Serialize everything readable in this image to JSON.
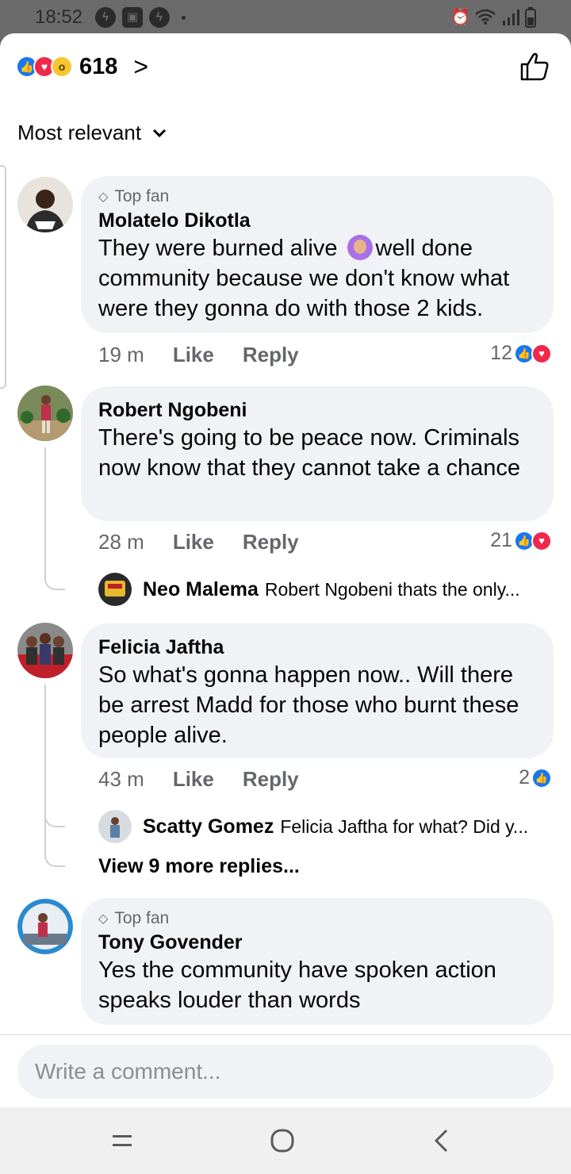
{
  "status_bar": {
    "time": "18:52",
    "left_icons": [
      "messenger-icon",
      "image-icon",
      "notification-icon"
    ],
    "right_icons": [
      "alarm-icon",
      "wifi-icon",
      "signal-icon",
      "battery-icon"
    ]
  },
  "header": {
    "reaction_count": "618",
    "reaction_types": [
      "like",
      "love",
      "wow"
    ]
  },
  "sort": {
    "label": "Most relevant"
  },
  "comments": [
    {
      "badge": "Top fan",
      "author": "Molatelo Dikotla",
      "text_before_emoji": "They were burned alive ",
      "text_after_emoji": "well done community because we don't know what were they gonna do with those 2 kids.",
      "time": "19 m",
      "like": "Like",
      "reply": "Reply",
      "reactions": "12"
    },
    {
      "author": "Robert Ngobeni",
      "text": "There's going to be peace now. Criminals now know that they cannot take a chance",
      "time": "28 m",
      "like": "Like",
      "reply": "Reply",
      "reactions": "21",
      "reply_preview": {
        "name": "Neo Malema",
        "snippet": "Robert Ngobeni thats the only..."
      }
    },
    {
      "author": "Felicia Jaftha",
      "text": "So what's gonna happen now.. Will there be arrest Madd for those who burnt these people alive.",
      "time": "43 m",
      "like": "Like",
      "reply": "Reply",
      "reactions": "2",
      "reply_preview": {
        "name": "Scatty Gomez",
        "snippet": "Felicia Jaftha for what? Did y..."
      },
      "view_more": "View 9 more replies..."
    },
    {
      "badge": "Top fan",
      "author": "Tony Govender",
      "text": "Yes the community have spoken action speaks louder than words"
    }
  ],
  "composer": {
    "placeholder": "Write a comment..."
  },
  "colors": {
    "accent": "#1877f2",
    "love": "#f0284a",
    "bubble": "#f0f2f5",
    "muted": "#65676b"
  }
}
